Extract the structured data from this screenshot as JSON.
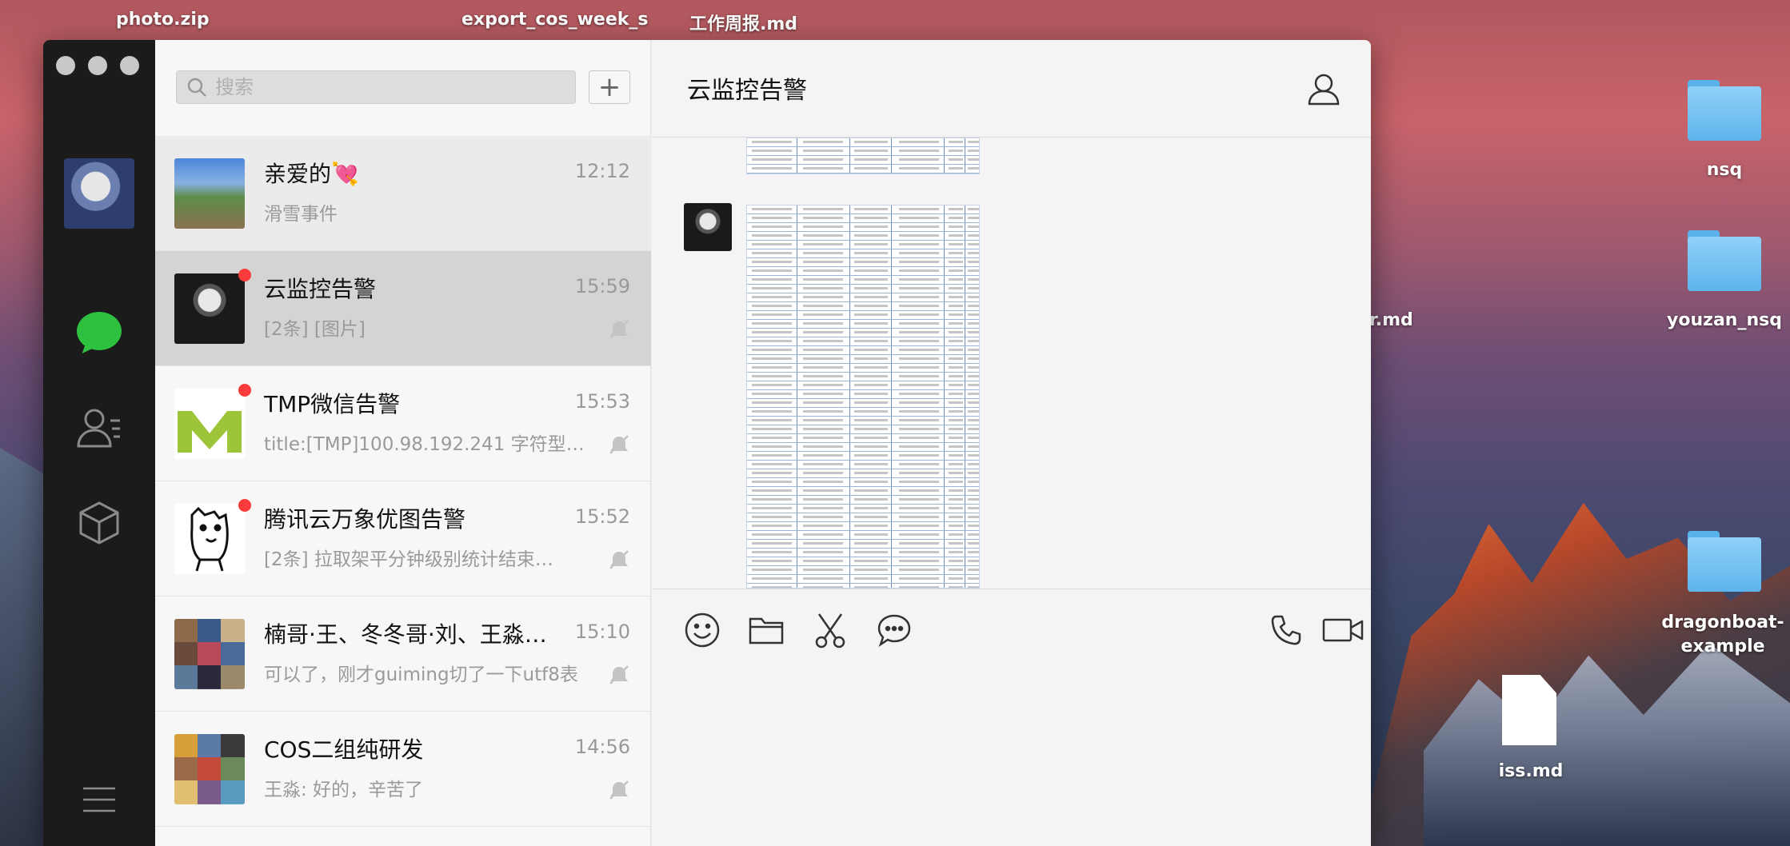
{
  "desktop": {
    "top_files": [
      "photo.zip",
      "export_cos_week_s",
      "工作周报.md"
    ],
    "partial_file": "r.md",
    "icons": [
      {
        "label": "nsq",
        "type": "folder"
      },
      {
        "label": "youzan_nsq",
        "type": "folder"
      },
      {
        "label": "dragonboat-\nexample",
        "type": "folder"
      },
      {
        "label": "iss.md",
        "type": "document"
      }
    ]
  },
  "sidebar": {
    "nav": [
      {
        "name": "chats",
        "icon": "chat-bubble-icon",
        "active": true
      },
      {
        "name": "contacts",
        "icon": "contacts-icon"
      },
      {
        "name": "mini-programs",
        "icon": "cube-icon"
      },
      {
        "name": "menu",
        "icon": "hamburger-icon"
      }
    ]
  },
  "search": {
    "placeholder": "搜索",
    "add_label": "+"
  },
  "conversations": [
    {
      "name": "亲爱的💘",
      "time": "12:12",
      "preview": "滑雪事件",
      "unread_dot": false,
      "muted": false,
      "state": "pinned"
    },
    {
      "name": "云监控告警",
      "time": "15:59",
      "preview": "[2条] [图片]",
      "unread_dot": true,
      "muted": true,
      "state": "selected"
    },
    {
      "name": "TMP微信告警",
      "time": "15:53",
      "preview": "title:[TMP]100.98.192.241 字符型业务…",
      "unread_dot": true,
      "muted": true,
      "state": "normal"
    },
    {
      "name": "腾讯云万象优图告警",
      "time": "15:52",
      "preview": "[2条] 拉取架平分钟级别统计结束…",
      "unread_dot": true,
      "muted": true,
      "state": "normal"
    },
    {
      "name": "楠哥·王、冬冬哥·刘、王淼…",
      "time": "15:10",
      "preview": "可以了，刚才guiming切了一下utf8表",
      "unread_dot": false,
      "muted": true,
      "state": "normal"
    },
    {
      "name": "COS二组纯研发",
      "time": "14:56",
      "preview": "王淼: 好的，辛苦了",
      "unread_dot": false,
      "muted": true,
      "state": "normal"
    }
  ],
  "chat": {
    "title": "云监控告警",
    "profile_icon": "person-icon",
    "messages": [
      {
        "type": "image",
        "content": "spreadsheet-screenshot"
      },
      {
        "type": "image",
        "content": "spreadsheet-screenshot"
      }
    ],
    "toolbar": [
      "emoji-icon",
      "folder-icon",
      "scissors-icon",
      "chat-history-icon",
      "phone-icon",
      "video-icon"
    ]
  },
  "colors": {
    "accent_green": "#2dc13f",
    "unread_red": "#fa3b3b",
    "rail": "#1b1b1b"
  }
}
